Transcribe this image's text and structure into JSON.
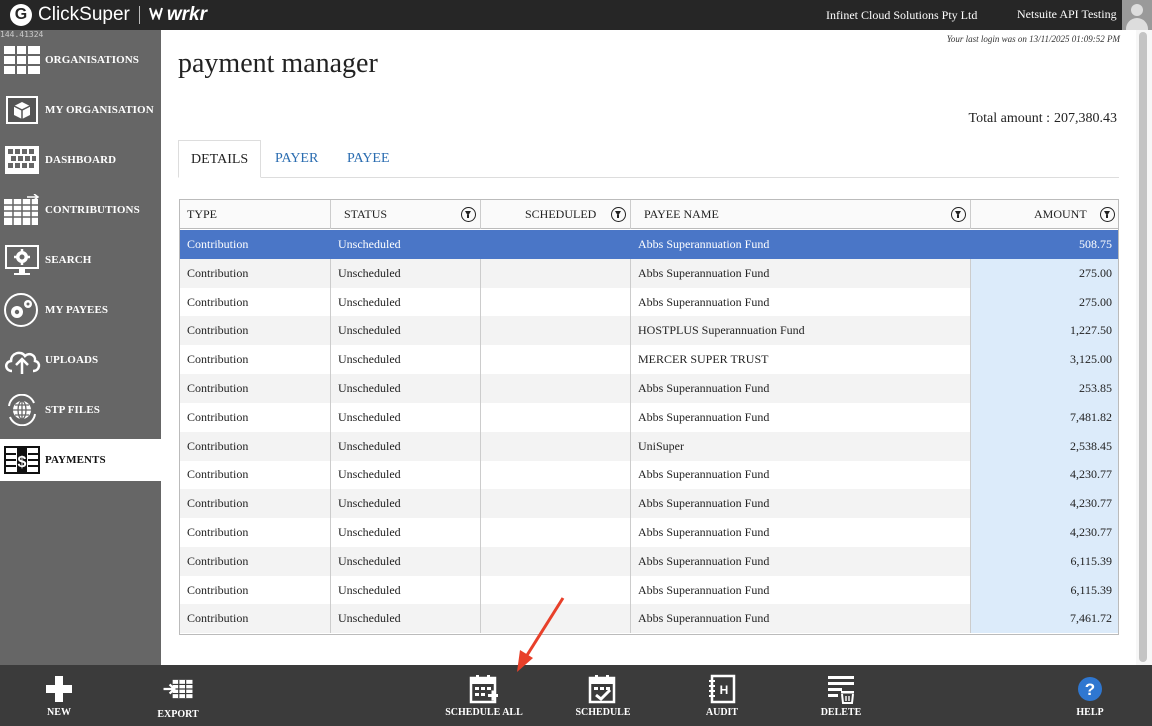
{
  "header": {
    "brand_name": "ClickSuper",
    "brand_g": "G",
    "partner_name": "wrkr",
    "organisation": "Infinet Cloud Solutions Pty Ltd",
    "user": "Netsuite API Testing"
  },
  "sidebar": {
    "version": "144.41324",
    "items": [
      {
        "label": "ORGANISATIONS",
        "icon": "organisations-grid-icon"
      },
      {
        "label": "MY ORGANISATION",
        "icon": "cube-icon"
      },
      {
        "label": "DASHBOARD",
        "icon": "dashboard-grid-icon"
      },
      {
        "label": "CONTRIBUTIONS",
        "icon": "contributions-table-icon"
      },
      {
        "label": "SEARCH",
        "icon": "gear-monitor-icon"
      },
      {
        "label": "MY PAYEES",
        "icon": "payees-gear-icon"
      },
      {
        "label": "UPLOADS",
        "icon": "cloud-upload-icon"
      },
      {
        "label": "STP FILES",
        "icon": "globe-refresh-icon"
      },
      {
        "label": "PAYMENTS",
        "icon": "dollar-table-icon",
        "active": true
      }
    ]
  },
  "main": {
    "title": "payment manager",
    "last_login": "Your last login was on 13/11/2025 01:09:52 PM",
    "total_label": "Total amount :",
    "total_value": "207,380.43",
    "tabs": [
      {
        "label": "DETAILS",
        "active": true
      },
      {
        "label": "PAYER",
        "active": false
      },
      {
        "label": "PAYEE",
        "active": false
      }
    ]
  },
  "table": {
    "columns": {
      "type": "TYPE",
      "status": "STATUS",
      "scheduled": "SCHEDULED",
      "payee": "PAYEE NAME",
      "amount": "AMOUNT"
    },
    "rows": [
      {
        "type": "Contribution",
        "status": "Unscheduled",
        "scheduled": "",
        "payee": "Abbs Superannuation Fund",
        "amount": "508.75",
        "selected": true
      },
      {
        "type": "Contribution",
        "status": "Unscheduled",
        "scheduled": "",
        "payee": "Abbs Superannuation Fund",
        "amount": "275.00"
      },
      {
        "type": "Contribution",
        "status": "Unscheduled",
        "scheduled": "",
        "payee": "Abbs Superannuation Fund",
        "amount": "275.00"
      },
      {
        "type": "Contribution",
        "status": "Unscheduled",
        "scheduled": "",
        "payee": "HOSTPLUS Superannuation Fund",
        "amount": "1,227.50"
      },
      {
        "type": "Contribution",
        "status": "Unscheduled",
        "scheduled": "",
        "payee": "MERCER SUPER TRUST",
        "amount": "3,125.00"
      },
      {
        "type": "Contribution",
        "status": "Unscheduled",
        "scheduled": "",
        "payee": "Abbs Superannuation Fund",
        "amount": "253.85"
      },
      {
        "type": "Contribution",
        "status": "Unscheduled",
        "scheduled": "",
        "payee": "Abbs Superannuation Fund",
        "amount": "7,481.82"
      },
      {
        "type": "Contribution",
        "status": "Unscheduled",
        "scheduled": "",
        "payee": "UniSuper",
        "amount": "2,538.45"
      },
      {
        "type": "Contribution",
        "status": "Unscheduled",
        "scheduled": "",
        "payee": "Abbs Superannuation Fund",
        "amount": "4,230.77"
      },
      {
        "type": "Contribution",
        "status": "Unscheduled",
        "scheduled": "",
        "payee": "Abbs Superannuation Fund",
        "amount": "4,230.77"
      },
      {
        "type": "Contribution",
        "status": "Unscheduled",
        "scheduled": "",
        "payee": "Abbs Superannuation Fund",
        "amount": "4,230.77"
      },
      {
        "type": "Contribution",
        "status": "Unscheduled",
        "scheduled": "",
        "payee": "Abbs Superannuation Fund",
        "amount": "6,115.39"
      },
      {
        "type": "Contribution",
        "status": "Unscheduled",
        "scheduled": "",
        "payee": "Abbs Superannuation Fund",
        "amount": "6,115.39"
      },
      {
        "type": "Contribution",
        "status": "Unscheduled",
        "scheduled": "",
        "payee": "Abbs Superannuation Fund",
        "amount": "7,461.72"
      }
    ]
  },
  "toolbar": {
    "new": "NEW",
    "export": "EXPORT",
    "schedule_all": "SCHEDULE ALL",
    "schedule": "SCHEDULE",
    "audit": "AUDIT",
    "delete": "DELETE",
    "help": "HELP"
  },
  "colors": {
    "topbar": "#262626",
    "sidebar": "#666666",
    "bottombar": "#3b3b3b",
    "selected_row": "#4a76c7",
    "amount_column": "#dcebfa",
    "link": "#2a6cb0",
    "help": "#2f77d0",
    "annotation_arrow": "#e8402a"
  }
}
